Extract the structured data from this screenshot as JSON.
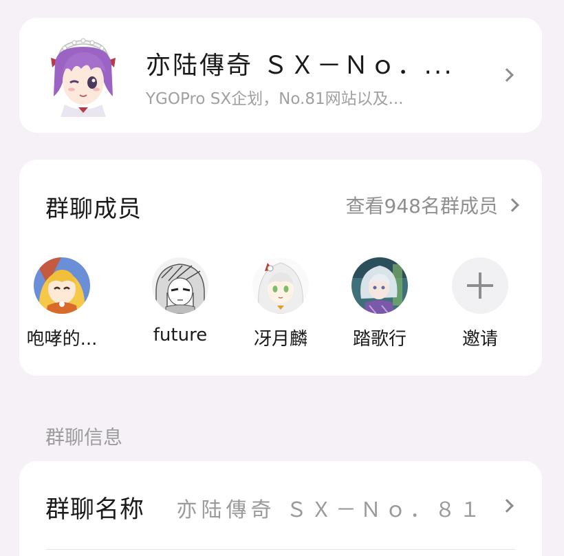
{
  "group": {
    "name": "亦陆傳奇 ＳＸ－Ｎｏ．...",
    "description": "YGOPro SX企划，No.81网站以及...",
    "avatar_icon": "anime-girl-avatar-icon"
  },
  "members": {
    "title": "群聊成员",
    "view_all": "查看948名群成员",
    "list": [
      {
        "name": "咆哮的...",
        "avatar_icon": "blonde-anime-avatar-icon"
      },
      {
        "name": "future",
        "avatar_icon": "sketch-anime-avatar-icon"
      },
      {
        "name": "冴月麟",
        "avatar_icon": "white-hood-anime-avatar-icon"
      },
      {
        "name": "踏歌行",
        "avatar_icon": "fairy-anime-avatar-icon"
      }
    ],
    "invite_label": "邀请",
    "invite_icon": "plus-icon"
  },
  "info_section": {
    "label": "群聊信息",
    "name_row": {
      "label": "群聊名称",
      "value": "亦陆傳奇 ＳＸ－Ｎｏ．８１"
    }
  },
  "colors": {
    "background": "#f5f1f7",
    "card": "#ffffff",
    "primary_text": "#1a1a1a",
    "secondary_text": "#a0a0a0"
  }
}
